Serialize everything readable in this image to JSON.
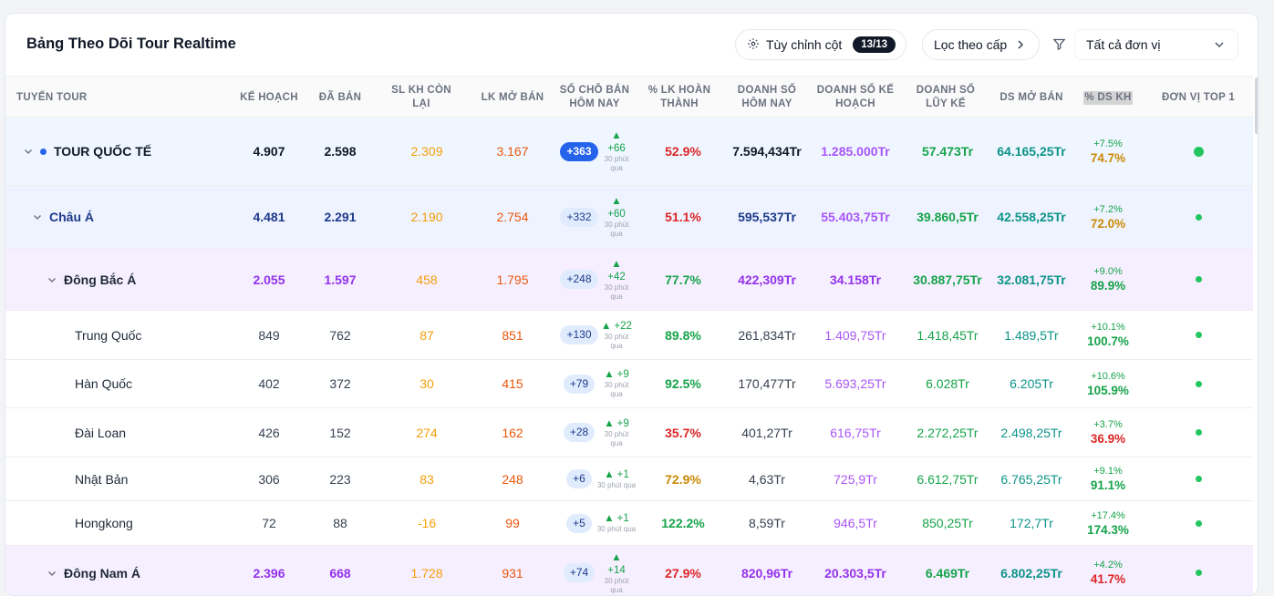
{
  "title": "Bảng Theo Dõi Tour Realtime",
  "toolbar": {
    "customize_label": "Tùy chỉnh cột",
    "customize_badge": "13/13",
    "filter_level_label": "Lọc theo cấp",
    "unit_select_value": "Tất cả đơn vị"
  },
  "columns": {
    "route": "TUYẾN TOUR",
    "plan": "KẾ HOẠCH",
    "sold": "ĐÃ BÁN",
    "remaining_l1": "SL KH CÒN",
    "remaining_l2": "LẠI",
    "opened": "LK MỞ BÁN",
    "seats_today_l1": "SỐ CHỖ BÁN",
    "seats_today_l2": "HÔM NAY",
    "pct_done_l1": "% LK HOÀN",
    "pct_done_l2": "THÀNH",
    "rev_today_l1": "DOANH SỐ",
    "rev_today_l2": "HÔM NAY",
    "rev_plan_l1": "DOANH SỐ KẾ",
    "rev_plan_l2": "HOẠCH",
    "rev_cum_l1": "DOANH SỐ",
    "rev_cum_l2": "LŨY KẾ",
    "rev_open": "DS MỞ BÁN",
    "pct_rev_plan": "% DS KH",
    "top_unit": "ĐƠN VỊ TOP 1"
  },
  "delta_sub": "30 phút qua",
  "colors": {
    "plan_orange": "#f59e0b",
    "opened_orange": "#ea580c",
    "red": "#dc2626",
    "green": "#16a34a",
    "purple": "#9333ea",
    "teal": "#0d9488",
    "navy": "#1e3a8a",
    "blue_pill": "#2563eb"
  },
  "rows": [
    {
      "level": 0,
      "name": "TOUR QUỐC TẾ",
      "plan": "4.907",
      "sold": "2.598",
      "remaining": "2.309",
      "opened": "3.167",
      "today": "+363",
      "delta": "+66",
      "pct_done": "52.9%",
      "rev_today": "7.594,434Tr",
      "rev_plan": "1.285.000Tr",
      "rev_cum": "57.473Tr",
      "rev_open": "64.165,25Tr",
      "pct_top": "+7.5%",
      "pct_main": "74.7%"
    },
    {
      "level": 1,
      "name": "Châu Á",
      "plan": "4.481",
      "sold": "2.291",
      "remaining": "2.190",
      "opened": "2.754",
      "today": "+332",
      "delta": "+60",
      "pct_done": "51.1%",
      "rev_today": "595,537Tr",
      "rev_plan": "55.403,75Tr",
      "rev_cum": "39.860,5Tr",
      "rev_open": "42.558,25Tr",
      "pct_top": "+7.2%",
      "pct_main": "72.0%"
    },
    {
      "level": 2,
      "name": "Đông Bắc Á",
      "plan": "2.055",
      "sold": "1.597",
      "remaining": "458",
      "opened": "1.795",
      "today": "+248",
      "delta": "+42",
      "pct_done": "77.7%",
      "rev_today": "422,309Tr",
      "rev_plan": "34.158Tr",
      "rev_cum": "30.887,75Tr",
      "rev_open": "32.081,75Tr",
      "pct_top": "+9.0%",
      "pct_main": "89.9%"
    },
    {
      "level": 3,
      "name": "Trung Quốc",
      "plan": "849",
      "sold": "762",
      "remaining": "87",
      "opened": "851",
      "today": "+130",
      "delta": "+22",
      "pct_done": "89.8%",
      "rev_today": "261,834Tr",
      "rev_plan": "1.409,75Tr",
      "rev_cum": "1.418,45Tr",
      "rev_open": "1.489,5Tr",
      "pct_top": "+10.1%",
      "pct_main": "100.7%"
    },
    {
      "level": 3,
      "name": "Hàn Quốc",
      "plan": "402",
      "sold": "372",
      "remaining": "30",
      "opened": "415",
      "today": "+79",
      "delta": "+9",
      "pct_done": "92.5%",
      "rev_today": "170,477Tr",
      "rev_plan": "5.693,25Tr",
      "rev_cum": "6.028Tr",
      "rev_open": "6.205Tr",
      "pct_top": "+10.6%",
      "pct_main": "105.9%"
    },
    {
      "level": 3,
      "name": "Đài Loan",
      "plan": "426",
      "sold": "152",
      "remaining": "274",
      "opened": "162",
      "today": "+28",
      "delta": "+9",
      "pct_done": "35.7%",
      "rev_today": "401,27Tr",
      "rev_plan": "616,75Tr",
      "rev_cum": "2.272,25Tr",
      "rev_open": "2.498,25Tr",
      "pct_top": "+3.7%",
      "pct_main": "36.9%"
    },
    {
      "level": 3,
      "name": "Nhật Bản",
      "plan": "306",
      "sold": "223",
      "remaining": "83",
      "opened": "248",
      "today": "+6",
      "delta": "+1",
      "pct_done": "72.9%",
      "rev_today": "4,63Tr",
      "rev_plan": "725,9Tr",
      "rev_cum": "6.612,75Tr",
      "rev_open": "6.765,25Tr",
      "pct_top": "+9.1%",
      "pct_main": "91.1%"
    },
    {
      "level": 3,
      "name": "Hongkong",
      "plan": "72",
      "sold": "88",
      "remaining": "-16",
      "opened": "99",
      "today": "+5",
      "delta": "+1",
      "pct_done": "122.2%",
      "rev_today": "8,59Tr",
      "rev_plan": "946,5Tr",
      "rev_cum": "850,25Tr",
      "rev_open": "172,7Tr",
      "pct_top": "+17.4%",
      "pct_main": "174.3%"
    },
    {
      "level": 2,
      "name": "Đông Nam Á",
      "plan": "2.396",
      "sold": "668",
      "remaining": "1.728",
      "opened": "931",
      "today": "+74",
      "delta": "+14",
      "pct_done": "27.9%",
      "rev_today": "820,96Tr",
      "rev_plan": "20.303,5Tr",
      "rev_cum": "6.469Tr",
      "rev_open": "6.802,25Tr",
      "pct_top": "+4.2%",
      "pct_main": "41.7%"
    }
  ]
}
